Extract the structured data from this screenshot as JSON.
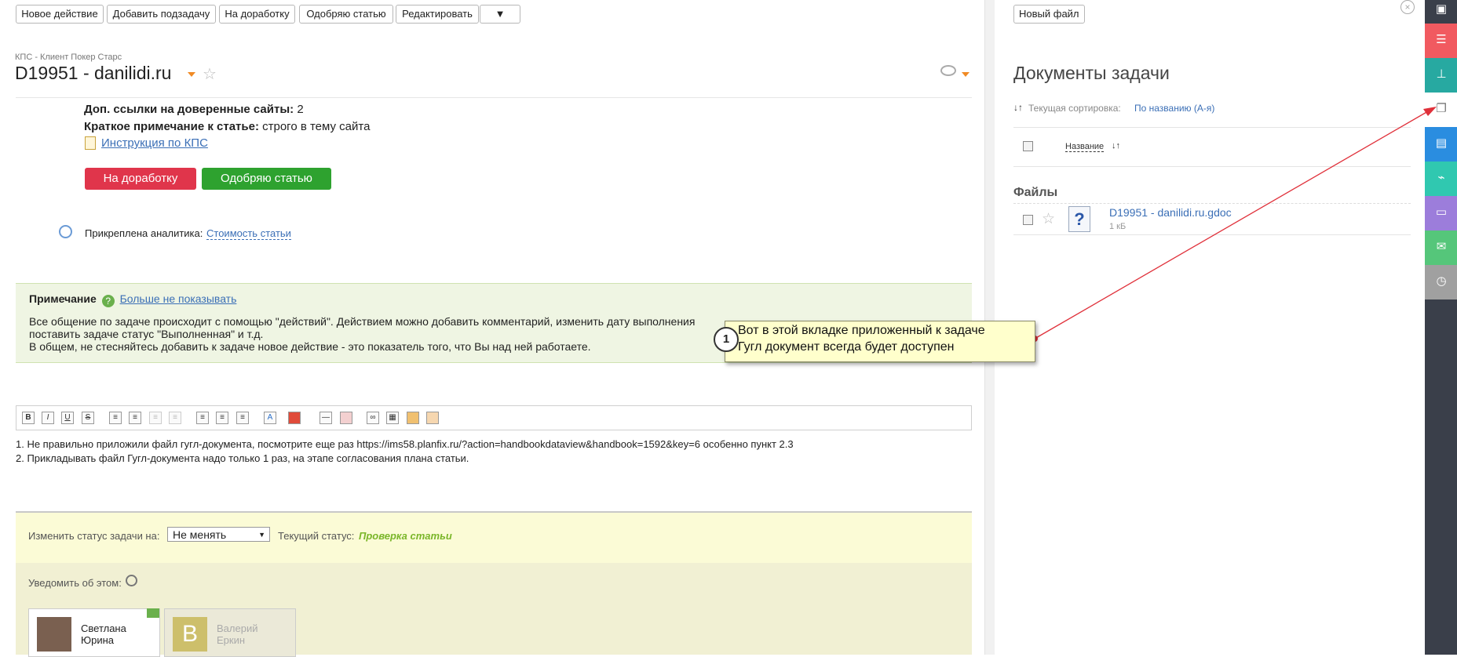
{
  "toolbar": {
    "new_action": "Новое действие",
    "add_subtask": "Добавить подзадачу",
    "rework": "На доработку",
    "approve": "Одобряю статью",
    "edit": "Редактировать",
    "more": "▼"
  },
  "task": {
    "project": "КПС - Клиент Покер Старс",
    "title": "D19951 - danilidi.ru"
  },
  "details": {
    "extra_links_label": "Доп. ссылки на доверенные сайты:",
    "extra_links_value": "2",
    "short_note_label": "Краткое примечание к статье:",
    "short_note_value": "строго в тему сайта",
    "instruction_link": "Инструкция по КПС"
  },
  "actions": {
    "rework": "На доработку",
    "approve": "Одобряю статью"
  },
  "analytics": {
    "label": "Прикреплена аналитика:",
    "link": "Стоимость статьи"
  },
  "note": {
    "title": "Примечание",
    "hide_link": "Больше не показывать",
    "line1": "Все общение по задаче происходит с помощью \"действий\". Действием можно добавить комментарий, изменить дату выполнения",
    "line2": "поставить задаче статус \"Выполненная\" и т.д.",
    "line3": "В общем, не стесняйтесь добавить к задаче новое действие - это показатель того, что Вы над ней работаете."
  },
  "editor": {
    "line1": "1. Не правильно приложили файл гугл-документа, посмотрите еще раз https://ims58.planfix.ru/?action=handbookdataview&handbook=1592&key=6 особенно пункт 2.3",
    "line2": "2. Прикладывать файл Гугл-документа надо только 1 раз, на этапе согласования плана статьи."
  },
  "status": {
    "change_label": "Изменить статус задачи на:",
    "select_value": "Не менять",
    "current_label": "Текущий статус:",
    "current_value": "Проверка статьи"
  },
  "notify": {
    "label": "Уведомить об этом:",
    "users": [
      {
        "name": "Светлана Юрина",
        "line1": "Светлана",
        "line2": "Юрина"
      },
      {
        "name": "Валерий Еркин",
        "line1": "Валерий",
        "line2": "Еркин",
        "initial": "В"
      }
    ]
  },
  "docs": {
    "new_file": "Новый файл",
    "title": "Документы задачи",
    "sort_label": "Текущая сортировка:",
    "sort_value": "По названию (А-я)",
    "col_name": "Название",
    "section": "Файлы",
    "file_name": "D19951 - danilidi.ru.gdoc",
    "file_size": "1 кБ"
  },
  "callout": {
    "number": "1",
    "line1": "Вот в этой вкладке приложенный к задаче",
    "line2": "Гугл документ всегда будет доступен"
  },
  "colors": {
    "danger": "#e0354b",
    "success": "#2ea22f",
    "link": "#3b6fb6",
    "status_green": "#7ab629"
  }
}
